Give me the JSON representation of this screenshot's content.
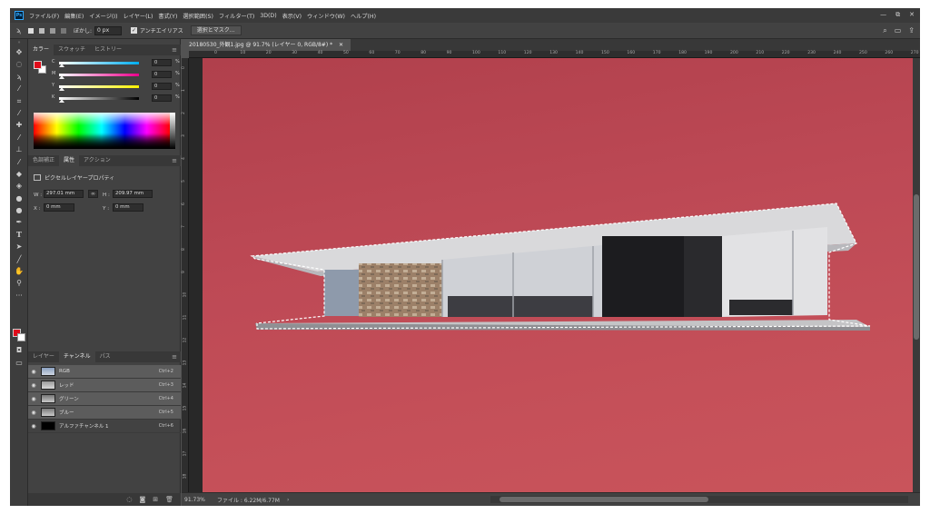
{
  "menubar": {
    "app_icon": "Ps",
    "items": [
      "ファイル(F)",
      "編集(E)",
      "イメージ(I)",
      "レイヤー(L)",
      "書式(Y)",
      "選択範囲(S)",
      "フィルター(T)",
      "3D(D)",
      "表示(V)",
      "ウィンドウ(W)",
      "ヘルプ(H)"
    ],
    "window_controls": [
      "—",
      "⧉",
      "✕"
    ]
  },
  "options": {
    "feather_label": "ぼかし:",
    "feather_value": "0 px",
    "antialias_label": "アンチエイリアス",
    "select_mask_button": "選択とマスク..."
  },
  "color_panel": {
    "tabs": [
      "カラー",
      "スウォッチ",
      "ヒストリー"
    ],
    "sliders": [
      {
        "label": "C",
        "value": "0",
        "unit": "%",
        "color_from": "#ffffff",
        "color_to": "#00aeef"
      },
      {
        "label": "M",
        "value": "0",
        "unit": "%",
        "color_from": "#ffffff",
        "color_to": "#ec008c"
      },
      {
        "label": "Y",
        "value": "0",
        "unit": "%",
        "color_from": "#ffffff",
        "color_to": "#fff200"
      },
      {
        "label": "K",
        "value": "0",
        "unit": "%",
        "color_from": "#ffffff",
        "color_to": "#000000"
      }
    ],
    "foreground_color": "#e00c1a",
    "background_color": "#ffffff"
  },
  "properties_panel": {
    "tabs": [
      "色調補正",
      "属性",
      "アクション"
    ],
    "title": "ピクセルレイヤープロパティ",
    "w_label": "W :",
    "w_value": "297.01 mm",
    "h_label": "H :",
    "h_value": "209.97 mm",
    "x_label": "X :",
    "x_value": "0 mm",
    "y_label": "Y :",
    "y_value": "0 mm"
  },
  "channels_panel": {
    "tabs": [
      "レイヤー",
      "チャンネル",
      "パス"
    ],
    "rows": [
      {
        "name": "RGB",
        "shortcut": "Ctrl+2"
      },
      {
        "name": "レッド",
        "shortcut": "Ctrl+3"
      },
      {
        "name": "グリーン",
        "shortcut": "Ctrl+4"
      },
      {
        "name": "ブルー",
        "shortcut": "Ctrl+5"
      },
      {
        "name": "アルファチャンネル 1",
        "shortcut": "Ctrl+6"
      }
    ]
  },
  "document": {
    "tab_title": "20180530_外観1.jpg @ 91.7% (レイヤー 0, RGB/8#) *",
    "ruler_labels": [
      "0",
      "10",
      "20",
      "30",
      "40",
      "50",
      "60",
      "70",
      "80",
      "90",
      "100",
      "110",
      "120",
      "130",
      "140",
      "150",
      "160",
      "170",
      "180",
      "190",
      "200",
      "210",
      "220",
      "230",
      "240",
      "250",
      "260",
      "270"
    ],
    "ruler_v_labels": [
      "0",
      "1",
      "2",
      "3",
      "4",
      "5",
      "6",
      "7",
      "8",
      "9",
      "10",
      "11",
      "12",
      "13",
      "14",
      "15",
      "16",
      "17",
      "18"
    ],
    "canvas_color": "#c24c57"
  },
  "status": {
    "zoom": "91.73%",
    "file_info": "ファイル : 6.22M/6.77M"
  }
}
